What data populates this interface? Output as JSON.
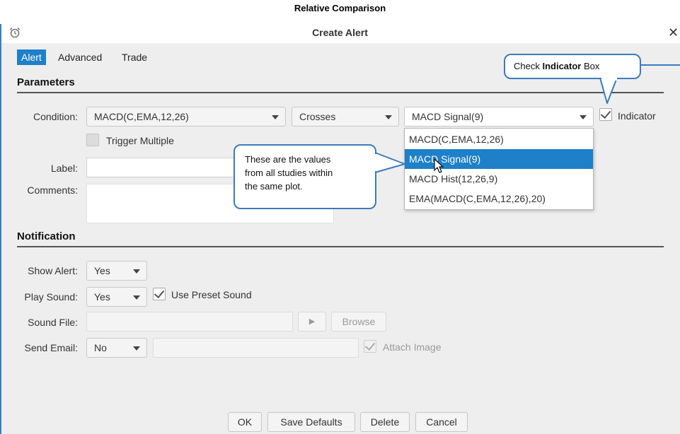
{
  "page": {
    "heading": "Relative Comparison"
  },
  "dialog": {
    "title": "Create Alert",
    "close_symbol": "✕"
  },
  "tabs": [
    {
      "label": "Alert",
      "active": true
    },
    {
      "label": "Advanced",
      "active": false
    },
    {
      "label": "Trade",
      "active": false
    }
  ],
  "parameters": {
    "heading": "Parameters",
    "condition_label": "Condition:",
    "condition_study": "MACD(C,EMA,12,26)",
    "condition_operator": "Crosses",
    "condition_target": "MACD Signal(9)",
    "indicator_label": "Indicator",
    "indicator_checked": true,
    "trigger_multiple_label": "Trigger Multiple",
    "trigger_multiple_checked": false,
    "label_label": "Label:",
    "label_value": "",
    "comments_label": "Comments:",
    "comments_value": ""
  },
  "target_dropdown": {
    "options": [
      "MACD(C,EMA,12,26)",
      "MACD Signal(9)",
      "MACD Hist(12,26,9)",
      "EMA(MACD(C,EMA,12,26),20)"
    ],
    "highlighted": "MACD Signal(9)"
  },
  "notification": {
    "heading": "Notification",
    "show_alert_label": "Show Alert:",
    "show_alert_value": "Yes",
    "play_sound_label": "Play Sound:",
    "play_sound_value": "Yes",
    "use_preset_sound_label": "Use Preset Sound",
    "use_preset_sound_checked": true,
    "sound_file_label": "Sound File:",
    "sound_file_value": "",
    "play_symbol": "▶",
    "browse_label": "Browse",
    "send_email_label": "Send Email:",
    "send_email_value": "No",
    "email_value": "",
    "attach_image_label": "Attach Image",
    "attach_image_checked": true
  },
  "buttons": {
    "ok": "OK",
    "save_defaults": "Save Defaults",
    "delete": "Delete",
    "cancel": "Cancel"
  },
  "annotations": {
    "indicator_callout_prefix": "Check ",
    "indicator_callout_bold": "Indicator",
    "indicator_callout_suffix": " Box",
    "values_callout": [
      "These are the values",
      "from all studies within",
      "the same plot."
    ]
  },
  "colors": {
    "accent": "#1e80c8",
    "callout_border": "#3a7bbf",
    "dialog_bg": "#eeeeee"
  }
}
